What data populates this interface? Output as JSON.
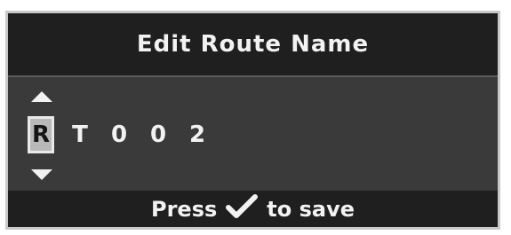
{
  "dialog": {
    "title": "Edit Route Name"
  },
  "editor": {
    "characters": [
      "R",
      "T",
      "0",
      "0",
      "2"
    ],
    "selected_index": 0
  },
  "footer": {
    "prefix": "Press",
    "suffix": "to save",
    "confirm_icon": "checkmark-icon"
  },
  "colors": {
    "background": "#2a2a2a",
    "selected_char_bg": "#b9b9b9",
    "text": "#f2f2f2"
  }
}
